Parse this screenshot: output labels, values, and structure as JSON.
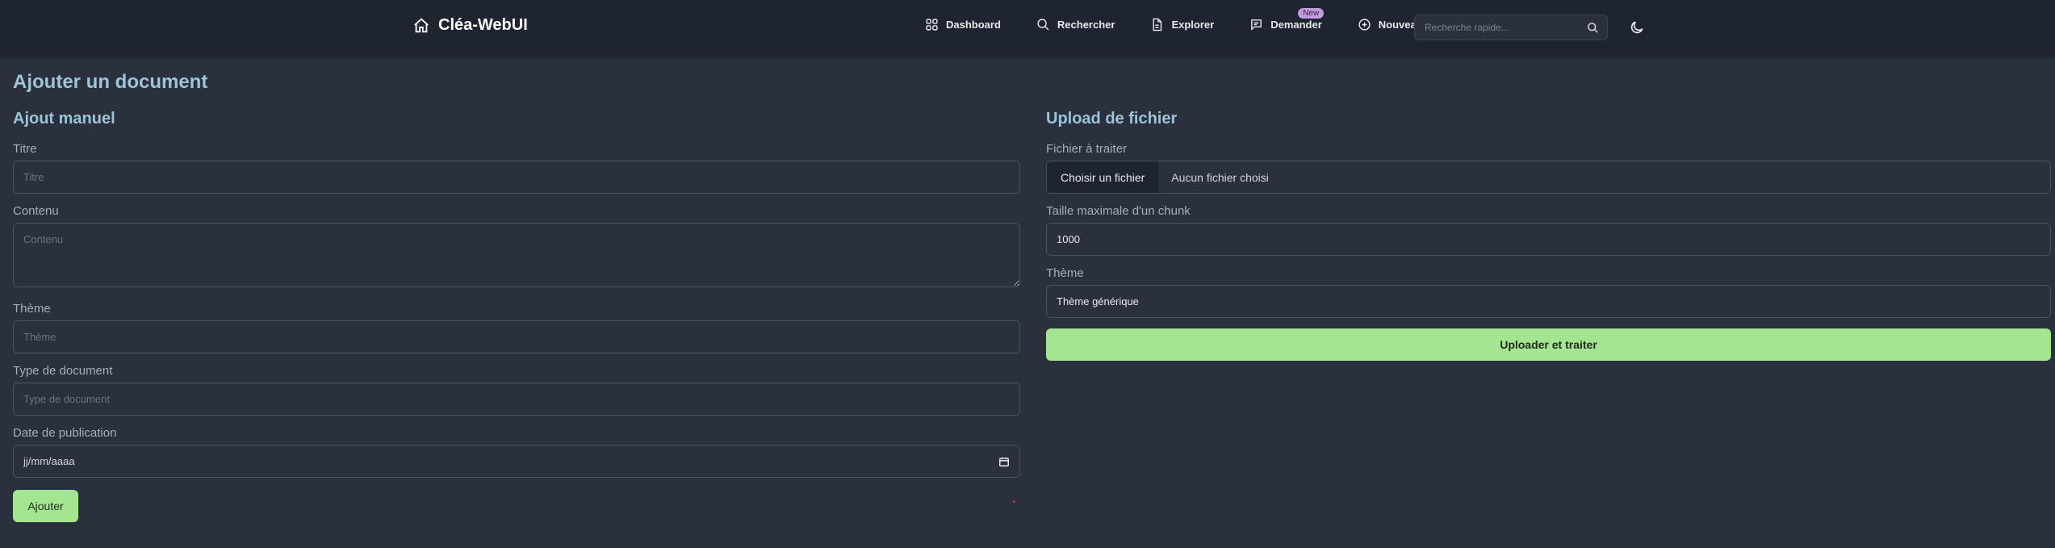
{
  "nav": {
    "brand": "Cléa-WebUI",
    "items": [
      {
        "label": "Dashboard",
        "icon": "grid-icon"
      },
      {
        "label": "Rechercher",
        "icon": "search-icon"
      },
      {
        "label": "Explorer",
        "icon": "document-icon"
      },
      {
        "label": "Demander",
        "icon": "chat-icon",
        "badge": "New"
      },
      {
        "label": "Nouveau",
        "icon": "plus-circle-icon"
      }
    ],
    "search_placeholder": "Recherche rapide..."
  },
  "page": {
    "title": "Ajouter un document"
  },
  "manual": {
    "title": "Ajout manuel",
    "titre_label": "Titre",
    "titre_placeholder": "Titre",
    "contenu_label": "Contenu",
    "contenu_placeholder": "Contenu",
    "theme_label": "Thème",
    "theme_placeholder": "Thème",
    "type_label": "Type de document",
    "type_placeholder": "Type de document",
    "date_label": "Date de publication",
    "date_value": "jj/mm/aaaa",
    "submit": "Ajouter"
  },
  "upload": {
    "title": "Upload de fichier",
    "file_label": "Fichier à traiter",
    "file_button": "Choisir un fichier",
    "file_status": "Aucun fichier choisi",
    "chunk_label": "Taille maximale d'un chunk",
    "chunk_value": "1000",
    "theme_label": "Thème",
    "theme_value": "Thème générique",
    "submit": "Uploader et traiter"
  }
}
